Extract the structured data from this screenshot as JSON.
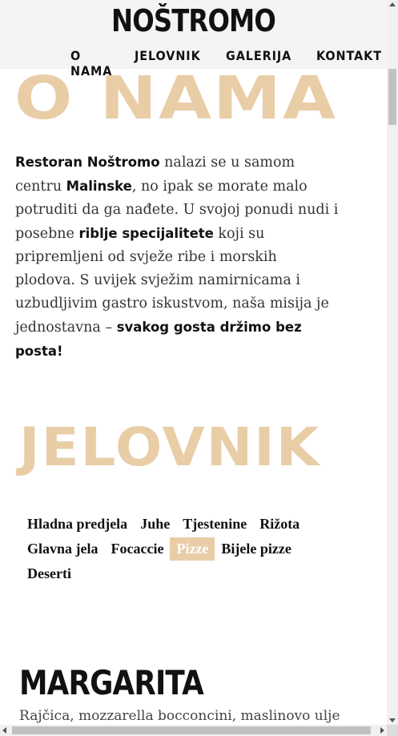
{
  "header": {
    "logo": "NOŠTROMO",
    "nav": [
      "O NAMA",
      "JELOVNIK",
      "GALERIJA",
      "KONTAKT"
    ]
  },
  "about": {
    "title": "O NAMA",
    "p1_bold": "Restoran Noštromo",
    "p2": " nalazi se u samom centru ",
    "p3_bold": "Malinske",
    "p4": ", no ipak se morate malo potruditi da ga nađete. U svojoj ponudi nudi i posebne ",
    "p5_bold": "riblje specijalitete",
    "p6": " koji su pripremljeni od svježe ribe i morskih plodova. S uvijek svježim namirnicama i uzbudljivim gastro iskustvom, naša misija je jednostavna – ",
    "p7_bold": "svakog gosta držimo bez posta!"
  },
  "menu": {
    "title": "JELOVNIK",
    "tabs": [
      "Hladna predjela",
      "Juhe",
      "Tjestenine",
      "Rižota",
      "Glavna jela",
      "Focaccie",
      "Pizze",
      "Bijele pizze",
      "Deserti"
    ],
    "active_tab": "Pizze",
    "dish": {
      "name": "MARGARITA",
      "description": "Rajčica, mozzarella bocconcini, maslinovo ulje"
    }
  },
  "colors": {
    "accent": "#e8cda6",
    "header_bg": "#f4f4f4"
  }
}
